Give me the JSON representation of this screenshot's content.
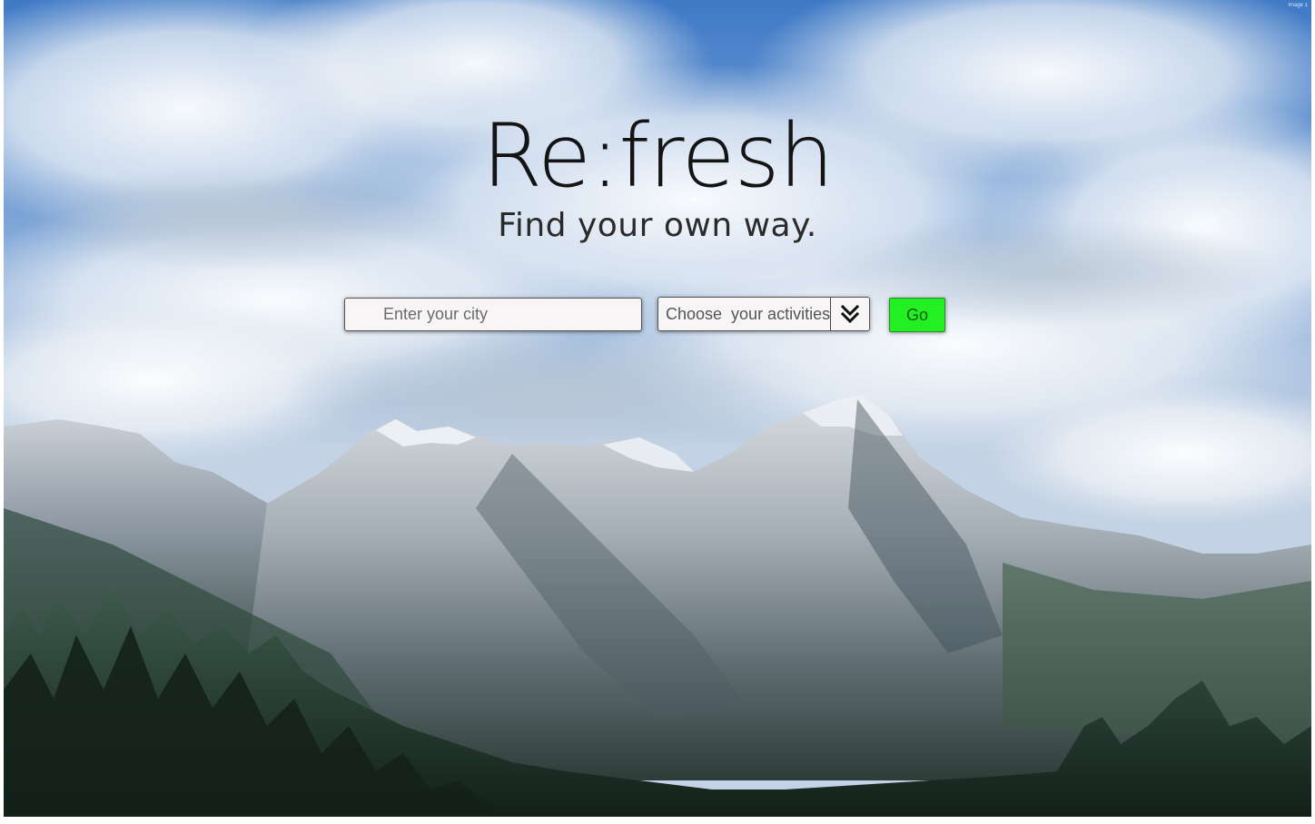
{
  "hero": {
    "title": "Re:fresh",
    "subtitle": "Find your own way."
  },
  "search": {
    "city_placeholder": "Enter your city",
    "activities_label": "Choose  your activities",
    "go_label": "Go"
  },
  "colors": {
    "go_button": "#22f022",
    "sky": "#5e8fc9",
    "input_background": "#f8f5f6"
  },
  "icons": {
    "dropdown": "double-chevron-down-icon"
  },
  "corner_label": "Image 1"
}
